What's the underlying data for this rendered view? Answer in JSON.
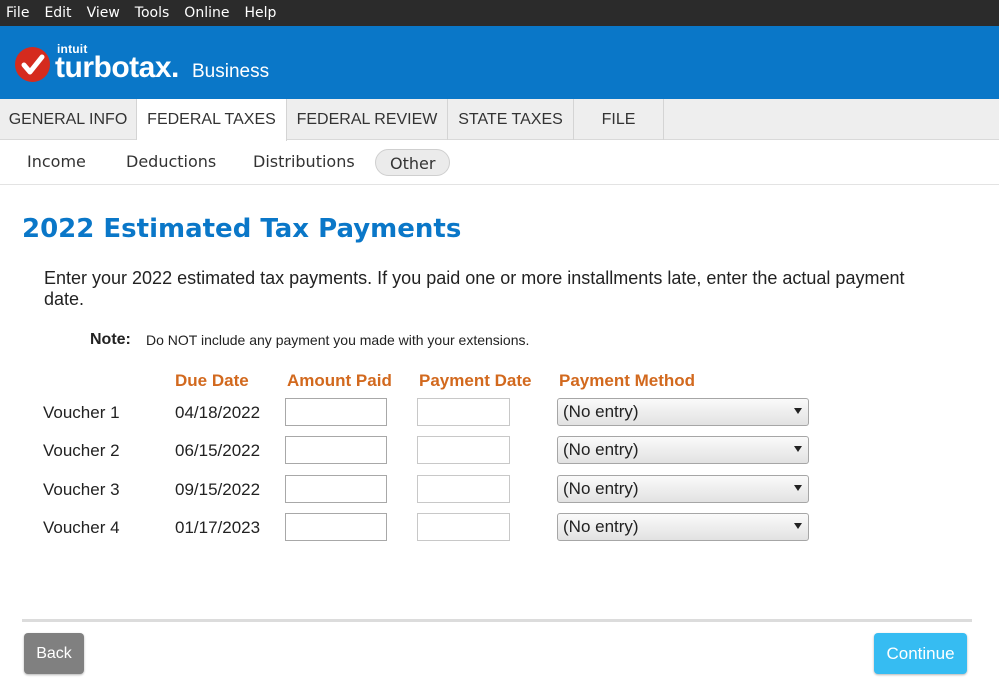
{
  "menu": [
    "File",
    "Edit",
    "View",
    "Tools",
    "Online",
    "Help"
  ],
  "brand": {
    "intuit": "intuit",
    "turbotax": "turbotax.",
    "business": "Business",
    "header_color": "#0a77c8",
    "check_color": "#d52b1e"
  },
  "tabs": [
    "GENERAL INFO",
    "FEDERAL TAXES",
    "FEDERAL REVIEW",
    "STATE TAXES",
    "FILE"
  ],
  "active_tab": "FEDERAL TAXES",
  "subtabs": [
    "Income",
    "Deductions",
    "Distributions",
    "Other"
  ],
  "active_subtab": "Other",
  "page": {
    "title": "2022 Estimated Tax Payments",
    "intro": "Enter your 2022 estimated tax payments. If you paid one or more installments late, enter the actual payment date.",
    "note_label": "Note:",
    "note_text": "Do NOT include any payment you made with your extensions."
  },
  "columns": {
    "due_date": "Due Date",
    "amount_paid": "Amount Paid",
    "payment_date": "Payment Date",
    "payment_method": "Payment Method"
  },
  "vouchers": [
    {
      "label": "Voucher 1",
      "due_date": "04/18/2022",
      "amount_paid": "",
      "payment_date": "",
      "payment_method": "(No entry)"
    },
    {
      "label": "Voucher 2",
      "due_date": "06/15/2022",
      "amount_paid": "",
      "payment_date": "",
      "payment_method": "(No entry)"
    },
    {
      "label": "Voucher 3",
      "due_date": "09/15/2022",
      "amount_paid": "",
      "payment_date": "",
      "payment_method": "(No entry)"
    },
    {
      "label": "Voucher 4",
      "due_date": "01/17/2023",
      "amount_paid": "",
      "payment_date": "",
      "payment_method": "(No entry)"
    }
  ],
  "buttons": {
    "back": "Back",
    "continue": "Continue"
  }
}
